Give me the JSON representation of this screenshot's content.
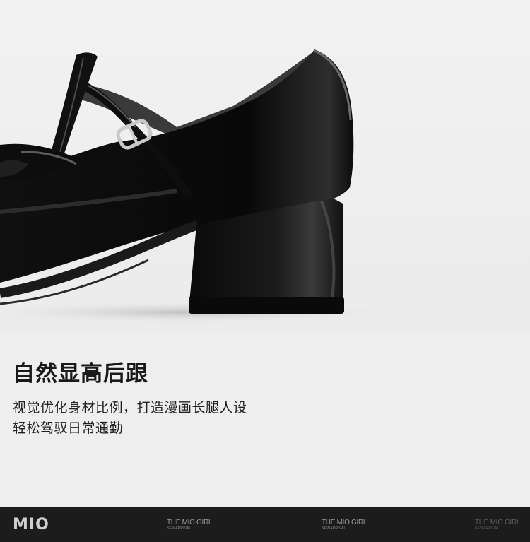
{
  "headline": "自然显高后跟",
  "description": [
    "视觉优化身材比例，打造漫画长腿人设",
    "轻松驾驭日常通勤"
  ],
  "footer": {
    "brand": "MIO",
    "tags": [
      {
        "title": "THE MIO GIRL",
        "sub": "NEWARRIVAL"
      },
      {
        "title": "THE MIO GIRL",
        "sub": "NEWARRIVAL"
      },
      {
        "title": "THE MIO GIRL",
        "sub": "NEWARRIVAL"
      }
    ]
  },
  "colors": {
    "background": "#eeeeee",
    "footer": "#1c1c1c",
    "shoe": "#0b0b0b"
  },
  "image": {
    "subject": "black patent leather Mary Jane shoe with block heel and T-strap buckle"
  }
}
